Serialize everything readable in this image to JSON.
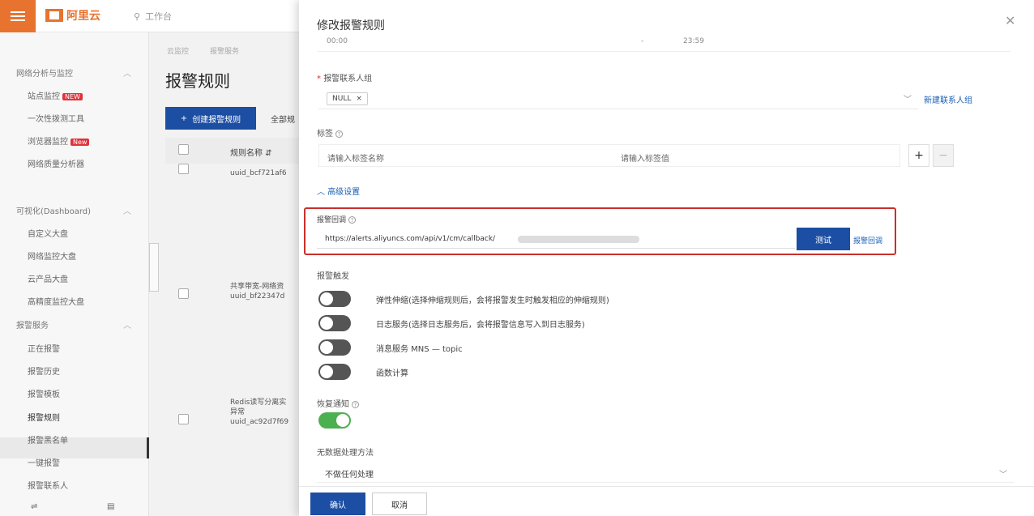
{
  "topbar": {
    "logo_text": "阿里云",
    "search_placeholder": "工作台"
  },
  "sidebar": {
    "groups": [
      {
        "label": "网络分析与监控",
        "items": [
          "站点监控",
          "一次性拨测工具",
          "浏览器监控",
          "网络质量分析器"
        ],
        "badges": [
          "NEW",
          "New"
        ]
      },
      {
        "label": "可视化(Dashboard)",
        "items": [
          "自定义大盘",
          "网络监控大盘",
          "云产品大盘",
          "高精度监控大盘"
        ]
      },
      {
        "label": "报警服务",
        "items": [
          "正在报警",
          "报警历史",
          "报警模板",
          "报警规则",
          "报警黑名单",
          "一键报警",
          "报警联系人"
        ]
      }
    ]
  },
  "main": {
    "breadcrumb": [
      "云监控",
      "报警服务"
    ],
    "title": "报警规则",
    "create_button": "创建报警规则",
    "all_filter": "全部规",
    "column_rule_name": "规则名称",
    "rows": [
      {
        "line1": "uuid_bcf721af6",
        "line2": ""
      },
      {
        "line1": "共享带宽-网络资",
        "line2": "uuid_bf22347d"
      },
      {
        "line1": "Redis读写分离实",
        "line2": "异常",
        "line3": "uuid_ac92d7f69"
      }
    ]
  },
  "drawer": {
    "title": "修改报警规则",
    "close_icon": "close-icon",
    "time_from": "00:00",
    "time_to": "23:59",
    "contact_group_label": "报警联系人组",
    "contact_tag": "NULL",
    "new_contact_link": "新建联系人组",
    "tags_label": "标签",
    "tag_name_placeholder": "请输入标签名称",
    "tag_value_placeholder": "请输入标签值",
    "advanced_label": "高级设置",
    "callback_label": "报警回调",
    "callback_url": "https://alerts.aliyuncs.com/api/v1/cm/callback/",
    "test_button": "测试",
    "callback_link": "报警回调",
    "trigger_label": "报警触发",
    "triggers": [
      {
        "label": "弹性伸缩(选择伸缩规则后，会将报警发生时触发相应的伸缩规则)",
        "on": false
      },
      {
        "label": "日志服务(选择日志服务后，会将报警信息写入到日志服务)",
        "on": false
      },
      {
        "label": "消息服务 MNS — topic",
        "on": false
      },
      {
        "label": "函数计算",
        "on": false
      }
    ],
    "recovery_label": "恢复通知",
    "recovery_on": true,
    "nodata_label": "无数据处理方法",
    "nodata_value": "不做任何处理",
    "confirm_button": "确认",
    "cancel_button": "取消"
  },
  "colors": {
    "primary": "#1c4ea3",
    "brand": "#e8732e",
    "highlight_border": "#c9302c",
    "toggle_on": "#4caf50"
  }
}
